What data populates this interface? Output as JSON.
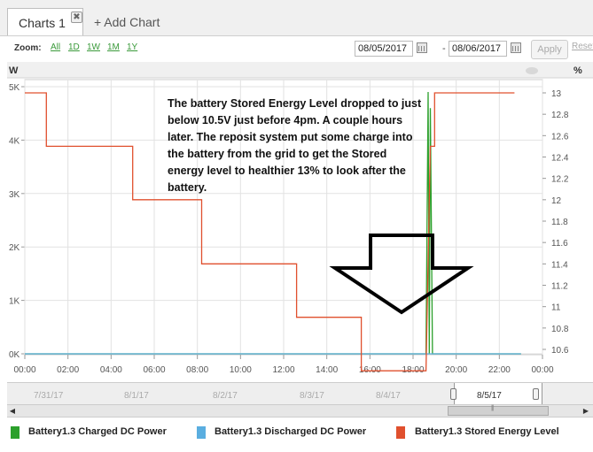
{
  "tabs": {
    "active_label": "Charts 1",
    "close_glyph": "✖",
    "add_label": "+ Add Chart"
  },
  "toolbar": {
    "zoom_label": "Zoom:",
    "zoom_links": [
      "All",
      "1D",
      "1W",
      "1M",
      "1Y"
    ],
    "from_date": "08/05/2017",
    "separator": "-",
    "to_date": "08/06/2017",
    "apply_label": "Apply",
    "reset_label": "Reset"
  },
  "annotation_text": "The battery Stored Energy Level dropped to just below 10.5V just before 4pm.  A couple hours later. The reposit system put some charge into the battery from the grid to get the Stored energy level to healthier 13% to look after the battery.",
  "navigator": {
    "labels": [
      "7/31/17",
      "8/1/17",
      "8/2/17",
      "8/3/17",
      "8/4/17"
    ],
    "selected_label": "8/5/17"
  },
  "scrollbar": {
    "left_glyph": "◀",
    "right_glyph": "▶"
  },
  "colors": {
    "charged": "#2ca02c",
    "discharged": "#5aaee0",
    "stored": "#e0502e",
    "grid": "#e2e2e2"
  },
  "chart_data": {
    "type": "line",
    "ylabel_left": "W",
    "ylabel_right": "%",
    "x_ticks": [
      "00:00",
      "02:00",
      "04:00",
      "06:00",
      "08:00",
      "10:00",
      "12:00",
      "14:00",
      "16:00",
      "18:00",
      "20:00",
      "22:00",
      "00:00"
    ],
    "xlim": [
      0,
      24
    ],
    "ylim_left": [
      0,
      5000
    ],
    "y_ticks_left": [
      "0K",
      "1K",
      "2K",
      "3K",
      "4K",
      "5K"
    ],
    "ylim_right": [
      10.4,
      13.1
    ],
    "y_ticks_right": [
      "10.6",
      "10.8",
      "11",
      "11.2",
      "11.4",
      "11.6",
      "11.8",
      "12",
      "12.2",
      "12.4",
      "12.6",
      "12.8",
      "13"
    ],
    "grid": true,
    "legend_position": "bottom",
    "series": [
      {
        "name": "Battery1.3 Charged DC Power",
        "axis": "left",
        "x": [
          0,
          18.6,
          18.7,
          18.75,
          18.8,
          18.9,
          23.0
        ],
        "y": [
          0,
          0,
          4900,
          0,
          4600,
          0,
          0
        ]
      },
      {
        "name": "Battery1.3 Discharged DC Power",
        "axis": "left",
        "x": [
          0,
          23.0
        ],
        "y": [
          0,
          0
        ]
      },
      {
        "name": "Battery1.3 Stored Energy Level",
        "axis": "right",
        "x": [
          0,
          1.0,
          1.0,
          5.0,
          5.0,
          8.2,
          8.2,
          12.6,
          12.6,
          15.6,
          15.6,
          18.6,
          18.8,
          19.0,
          19.0,
          22.7
        ],
        "y": [
          13,
          13,
          12.5,
          12.5,
          12,
          12,
          11.4,
          11.4,
          10.9,
          10.9,
          10.4,
          10.4,
          12.5,
          12.5,
          13,
          13
        ]
      }
    ]
  }
}
